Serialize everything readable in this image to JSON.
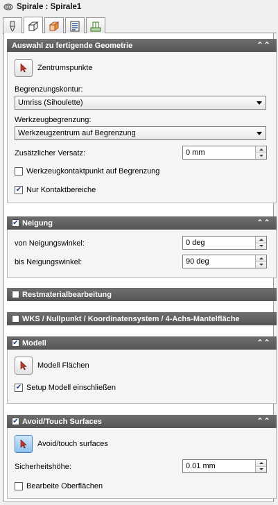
{
  "window": {
    "title": "Spirale : Spirale1",
    "title_icon": "spiral-icon"
  },
  "tabs": [
    {
      "icon": "tool-icon",
      "active": false
    },
    {
      "icon": "geometry-icon",
      "active": true
    },
    {
      "icon": "stock-box-icon",
      "active": false
    },
    {
      "icon": "list-sheet-icon",
      "active": false
    },
    {
      "icon": "setup-icon",
      "active": false
    }
  ],
  "sections": {
    "geometry": {
      "title": "Auswahl zu fertigende Geometrie",
      "pick_label": "Zentrumspunkte",
      "boundary_label": "Begrenzungskontur:",
      "boundary_value": "Umriss (Sihoulette)",
      "tool_boundary_label": "Werkzeugbegrenzung:",
      "tool_boundary_value": "Werkzeugzentrum auf Begrenzung",
      "offset_label": "Zusätzlicher Versatz:",
      "offset_value": "0 mm",
      "contact_point_label": "Werkzeugkontaktpunkt auf Begrenzung",
      "contact_point_checked": false,
      "contact_only_label": "Nur Kontaktbereiche",
      "contact_only_checked": true
    },
    "tilt": {
      "title": "Neigung",
      "enabled": true,
      "from_label": "von Neigungswinkel:",
      "from_value": "0 deg",
      "to_label": "bis Neigungswinkel:",
      "to_value": "90 deg"
    },
    "rest": {
      "title": "Restmaterialbearbeitung",
      "enabled": false
    },
    "wcs": {
      "title": "WKS / Nullpunkt / Koordinatensystem / 4-Achs-Mantelfläche",
      "enabled": false
    },
    "model": {
      "title": "Modell",
      "enabled": true,
      "pick_label": "Modell Flächen",
      "include_label": "Setup Modell einschließen",
      "include_checked": true
    },
    "avoid": {
      "title": "Avoid/Touch Surfaces",
      "enabled": true,
      "pick_label": "Avoid/touch surfaces",
      "safety_label": "Sicherheitshöhe:",
      "safety_value": "0.01 mm",
      "edit_label": "Bearbeite Oberflächen",
      "edit_checked": false
    }
  },
  "colors": {
    "header_bg": "#626262",
    "check_mark": "#1a3d7a",
    "cursor_red": "#c0392b"
  },
  "glyphs": {
    "check": "✔",
    "collapse": "⌃⌃"
  }
}
